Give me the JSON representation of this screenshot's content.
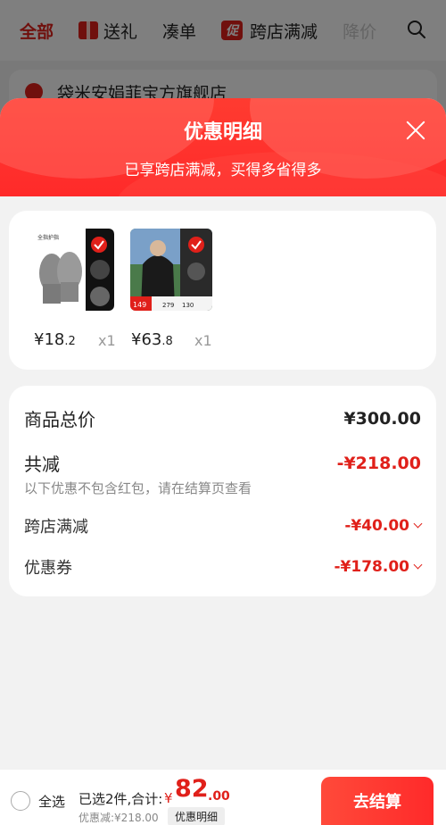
{
  "topbar": {
    "tabs": [
      {
        "label": "全部",
        "active": true
      },
      {
        "label": "送礼"
      },
      {
        "label": "凑单"
      },
      {
        "label": "跨店满减",
        "tag": "促"
      },
      {
        "label": "降价"
      }
    ],
    "icons": [
      "gift-icon",
      "search-icon"
    ]
  },
  "store": {
    "name": "袋米安娟菲宝方旗舰店"
  },
  "sheet": {
    "title": "优惠明细",
    "subtitle": "已享跨店满减，买得多省得多",
    "products": [
      {
        "price_int": "¥18",
        "price_dec": ".2",
        "qty": "x1",
        "thumb_caption": "全指护指"
      },
      {
        "price_int": "¥63",
        "price_dec": ".8",
        "qty": "x1",
        "thumb_prices": [
          "149",
          "279",
          "130"
        ]
      }
    ],
    "summary": {
      "total_label": "商品总价",
      "total_value": "¥300.00",
      "reduce_label": "共减",
      "reduce_value": "-¥218.00",
      "reduce_note": "以下优惠不包含红包，请在结算页查看",
      "items": [
        {
          "label": "跨店满减",
          "value": "-¥40.00"
        },
        {
          "label": "优惠券",
          "value": "-¥178.00"
        }
      ]
    }
  },
  "bottom": {
    "select_all": "全选",
    "selected_text": "已选2件,合计:",
    "currency": "¥",
    "total_int": "82",
    "total_dec": ".00",
    "discount_text": "优惠减:¥218.00",
    "detail_button": "优惠明细",
    "checkout_button": "去结算"
  },
  "colors": {
    "accent": "#e0201a",
    "sheet_header": "#ff2a2a"
  }
}
